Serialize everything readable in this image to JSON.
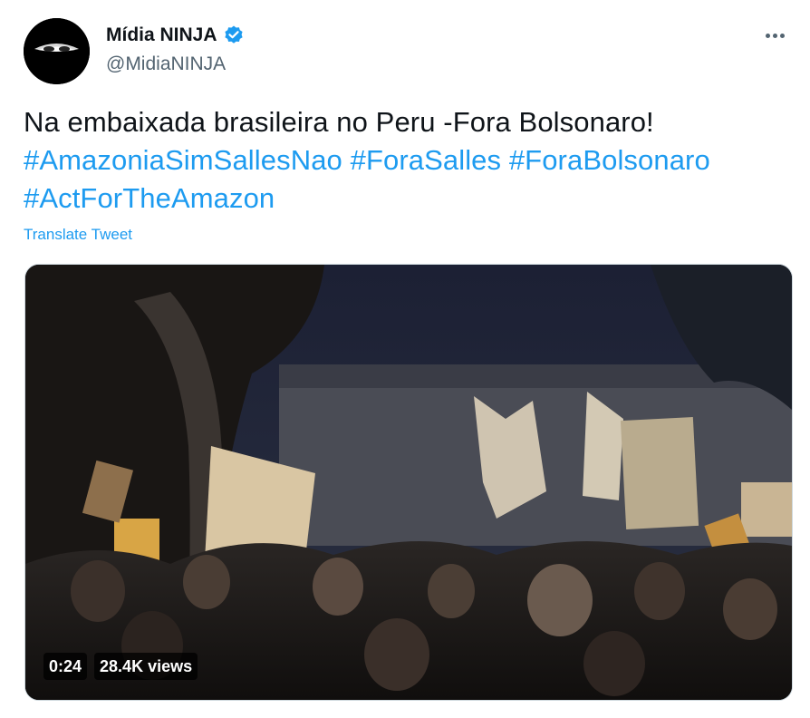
{
  "author": {
    "display_name": "Mídia NINJA",
    "handle": "@MidiaNINJA",
    "verified_icon": "verified-badge-icon"
  },
  "menu": {
    "icon": "more-options-icon"
  },
  "tweet": {
    "text": "Na embaixada brasileira no Peru -Fora Bolsonaro!",
    "hashtags": [
      "#AmazoniaSimSallesNao",
      "#ForaSalles",
      "#ForaBolsonaro",
      "#ActForTheAmazon"
    ],
    "translate_label": "Translate Tweet"
  },
  "video": {
    "duration": "0:24",
    "views": "28.4K views"
  },
  "colors": {
    "link": "#1d9bf0",
    "text": "#0f1419",
    "secondary": "#536471"
  }
}
